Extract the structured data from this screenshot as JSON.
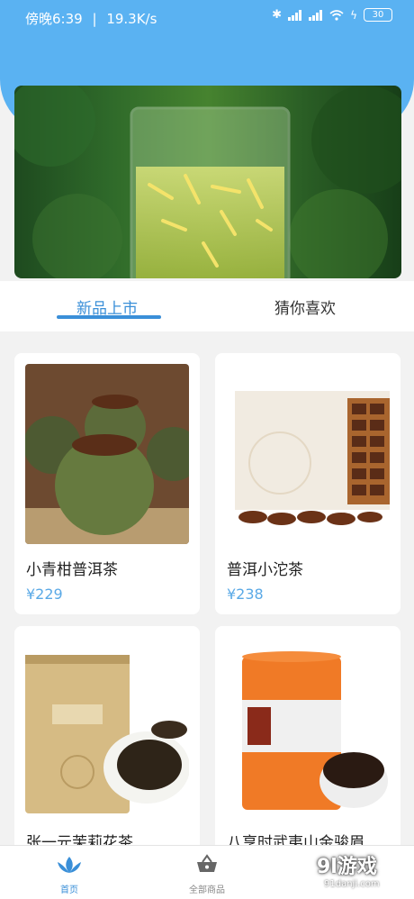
{
  "status_bar": {
    "time": "傍晚6:39",
    "speed": "19.3K/s",
    "battery": "30",
    "icons": [
      "bluetooth-icon",
      "signal-icon",
      "signal-icon",
      "wifi-icon",
      "charging-icon"
    ]
  },
  "banner": {
    "image": "glass-of-green-tea"
  },
  "tabs": [
    {
      "label": "新品上市",
      "active": true
    },
    {
      "label": "猜你喜欢",
      "active": false
    }
  ],
  "products": [
    {
      "name": "小青柑普洱茶",
      "price": "¥229",
      "image": "citrus-puer-tea"
    },
    {
      "name": "普洱小沱茶",
      "price": "¥238",
      "image": "puer-mini-tuo-tea-box"
    },
    {
      "name": "张一元茉莉花茶",
      "price": "",
      "image": "jasmine-tea-tin"
    },
    {
      "name": "八享时武夷山金骏眉",
      "price": "",
      "image": "orange-tea-can"
    }
  ],
  "bottom_nav": [
    {
      "label": "首页",
      "icon": "lotus-icon",
      "active": true
    },
    {
      "label": "全部商品",
      "icon": "basket-icon",
      "active": false
    }
  ],
  "watermark": {
    "text": "9l游戏",
    "site": "91danji.com"
  },
  "colors": {
    "accent": "#3a8fd8",
    "header": "#5ab2f2",
    "price": "#5aa9e6"
  }
}
